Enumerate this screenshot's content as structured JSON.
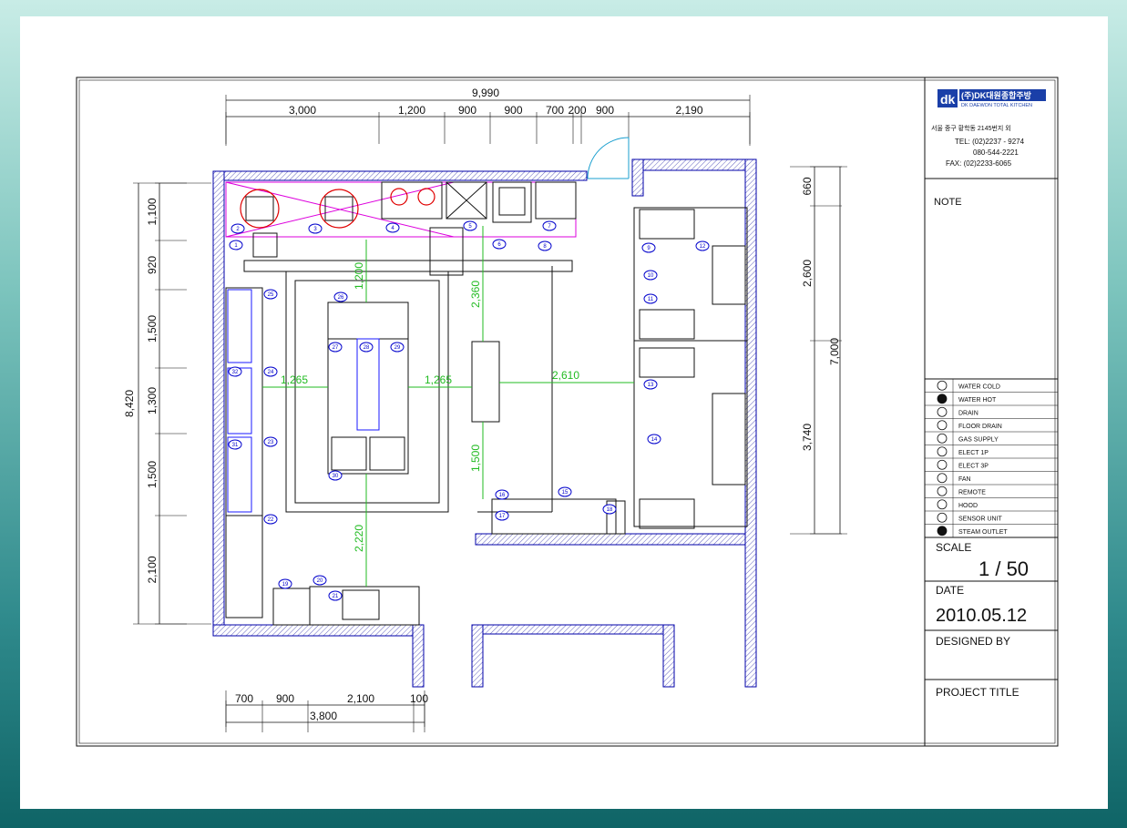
{
  "title_block": {
    "company_name": "(주)DK대원종합주방",
    "company_name_en": "DK DAEWON TOTAL KITCHEN",
    "address": "서울 중구 황학동 2145번지 외",
    "tel": "TEL: (02)2237 - 9274",
    "tel2": "080-544-2221",
    "fax": "FAX: (02)2233-6065",
    "note_label": "NOTE",
    "scale_label": "SCALE",
    "scale_value": "1 / 50",
    "date_label": "DATE",
    "date_value": "2010.05.12",
    "designed_by_label": "DESIGNED BY",
    "project_title_label": "PROJECT TITLE",
    "brand_color": "#1a3fa8"
  },
  "legend": [
    {
      "symbol": "water-cold-symbol",
      "label": "WATER COLD"
    },
    {
      "symbol": "water-hot-symbol",
      "label": "WATER HOT"
    },
    {
      "symbol": "drain-symbol",
      "label": "DRAIN"
    },
    {
      "symbol": "floor-drain-symbol",
      "label": "FLOOR DRAIN"
    },
    {
      "symbol": "gas-supply-symbol",
      "label": "GAS SUPPLY"
    },
    {
      "symbol": "electric-1p-symbol",
      "label": "ELECT 1P"
    },
    {
      "symbol": "electric-3p-symbol",
      "label": "ELECT 3P"
    },
    {
      "symbol": "fan-symbol",
      "label": "FAN"
    },
    {
      "symbol": "remote-symbol",
      "label": "REMOTE"
    },
    {
      "symbol": "hood-symbol",
      "label": "HOOD"
    },
    {
      "symbol": "sensor-unit-symbol",
      "label": "SENSOR UNIT"
    },
    {
      "symbol": "steam-outlet-symbol",
      "label": "STEAM OUTLET"
    }
  ],
  "dimensions": {
    "top_total": "9,990",
    "top_segments": [
      "3,000",
      "1,200",
      "900",
      "900",
      "700",
      "200",
      "900",
      "2,190"
    ],
    "left_total": "8,420",
    "left_segments": [
      "1,100",
      "920",
      "1,500",
      "1,300",
      "1,500",
      "2,100"
    ],
    "bottom_total": "3,800",
    "bottom_segments": [
      "700",
      "900",
      "2,100",
      "100"
    ],
    "right_total": "7,000",
    "right_segments": [
      "660",
      "2,600",
      "3,740"
    ],
    "inner": [
      "1,200",
      "2,360",
      "1,265",
      "1,265",
      "2,610",
      "1,500",
      "2,220"
    ]
  },
  "equipment_tags": [
    "1",
    "2",
    "3",
    "4",
    "5",
    "6",
    "7",
    "8",
    "9",
    "10",
    "11",
    "12",
    "13",
    "14",
    "15",
    "16",
    "17",
    "18",
    "19",
    "20",
    "21",
    "22",
    "23",
    "24",
    "25",
    "26",
    "27",
    "28",
    "29",
    "30",
    "31",
    "32"
  ]
}
